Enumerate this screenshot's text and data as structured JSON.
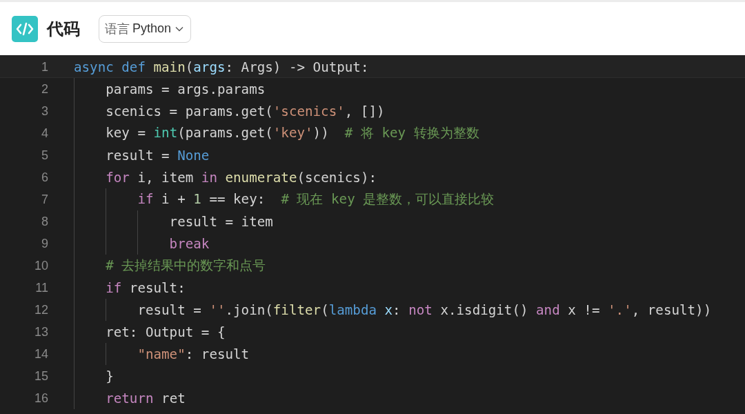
{
  "header": {
    "title": "代码",
    "language_select": {
      "label": "语言",
      "value": "Python"
    }
  },
  "editor": {
    "lines": [
      {
        "number": "1",
        "current": true,
        "tokens": [
          {
            "kind": "kw",
            "text": "async def"
          },
          {
            "kind": "fn",
            "text": " main"
          },
          {
            "kind": "plain",
            "text": "("
          },
          {
            "kind": "param",
            "text": "args"
          },
          {
            "kind": "plain",
            "text": ": Args) -> Output:"
          }
        ]
      },
      {
        "number": "2",
        "current": false,
        "tokens": [
          {
            "kind": "plain",
            "text": "    params = args.params"
          }
        ]
      },
      {
        "number": "3",
        "current": false,
        "tokens": [
          {
            "kind": "plain",
            "text": "    scenics = params.get("
          },
          {
            "kind": "str",
            "text": "'scenics'"
          },
          {
            "kind": "plain",
            "text": ", [])"
          }
        ]
      },
      {
        "number": "4",
        "current": false,
        "tokens": [
          {
            "kind": "plain",
            "text": "    key = "
          },
          {
            "kind": "type",
            "text": "int"
          },
          {
            "kind": "plain",
            "text": "(params.get("
          },
          {
            "kind": "str",
            "text": "'key'"
          },
          {
            "kind": "plain",
            "text": "))  "
          },
          {
            "kind": "cmt",
            "text": "# 将 key 转换为整数"
          }
        ]
      },
      {
        "number": "5",
        "current": false,
        "tokens": [
          {
            "kind": "plain",
            "text": "    result = "
          },
          {
            "kind": "kw",
            "text": "None"
          }
        ]
      },
      {
        "number": "6",
        "current": false,
        "tokens": [
          {
            "kind": "ctl",
            "text": "    for"
          },
          {
            "kind": "plain",
            "text": " i, item "
          },
          {
            "kind": "ctl",
            "text": "in"
          },
          {
            "kind": "fn",
            "text": " enumerate"
          },
          {
            "kind": "plain",
            "text": "(scenics):"
          }
        ]
      },
      {
        "number": "7",
        "current": false,
        "tokens": [
          {
            "kind": "ctl",
            "text": "        if"
          },
          {
            "kind": "plain",
            "text": " i + "
          },
          {
            "kind": "num",
            "text": "1"
          },
          {
            "kind": "plain",
            "text": " == key:  "
          },
          {
            "kind": "cmt",
            "text": "# 现在 key 是整数，可以直接比较"
          }
        ]
      },
      {
        "number": "8",
        "current": false,
        "tokens": [
          {
            "kind": "plain",
            "text": "            result = item"
          }
        ]
      },
      {
        "number": "9",
        "current": false,
        "tokens": [
          {
            "kind": "ctl",
            "text": "            break"
          }
        ]
      },
      {
        "number": "10",
        "current": false,
        "tokens": [
          {
            "kind": "cmt",
            "text": "    # 去掉结果中的数字和点号"
          }
        ]
      },
      {
        "number": "11",
        "current": false,
        "tokens": [
          {
            "kind": "ctl",
            "text": "    if"
          },
          {
            "kind": "plain",
            "text": " result:"
          }
        ]
      },
      {
        "number": "12",
        "current": false,
        "tokens": [
          {
            "kind": "plain",
            "text": "        result = "
          },
          {
            "kind": "str",
            "text": "''"
          },
          {
            "kind": "plain",
            "text": ".join("
          },
          {
            "kind": "fn",
            "text": "filter"
          },
          {
            "kind": "plain",
            "text": "("
          },
          {
            "kind": "kw",
            "text": "lambda"
          },
          {
            "kind": "param",
            "text": " x"
          },
          {
            "kind": "plain",
            "text": ": "
          },
          {
            "kind": "ctl",
            "text": "not"
          },
          {
            "kind": "plain",
            "text": " x.isdigit() "
          },
          {
            "kind": "ctl",
            "text": "and"
          },
          {
            "kind": "plain",
            "text": " x != "
          },
          {
            "kind": "str",
            "text": "'.'"
          },
          {
            "kind": "plain",
            "text": ", result))"
          }
        ]
      },
      {
        "number": "13",
        "current": false,
        "tokens": [
          {
            "kind": "plain",
            "text": "    ret: Output = {"
          }
        ]
      },
      {
        "number": "14",
        "current": false,
        "tokens": [
          {
            "kind": "str",
            "text": "        \"name\""
          },
          {
            "kind": "plain",
            "text": ": result"
          }
        ]
      },
      {
        "number": "15",
        "current": false,
        "tokens": [
          {
            "kind": "plain",
            "text": "    }"
          }
        ]
      },
      {
        "number": "16",
        "current": false,
        "tokens": [
          {
            "kind": "ctl",
            "text": "    return"
          },
          {
            "kind": "plain",
            "text": " ret"
          }
        ]
      }
    ]
  }
}
